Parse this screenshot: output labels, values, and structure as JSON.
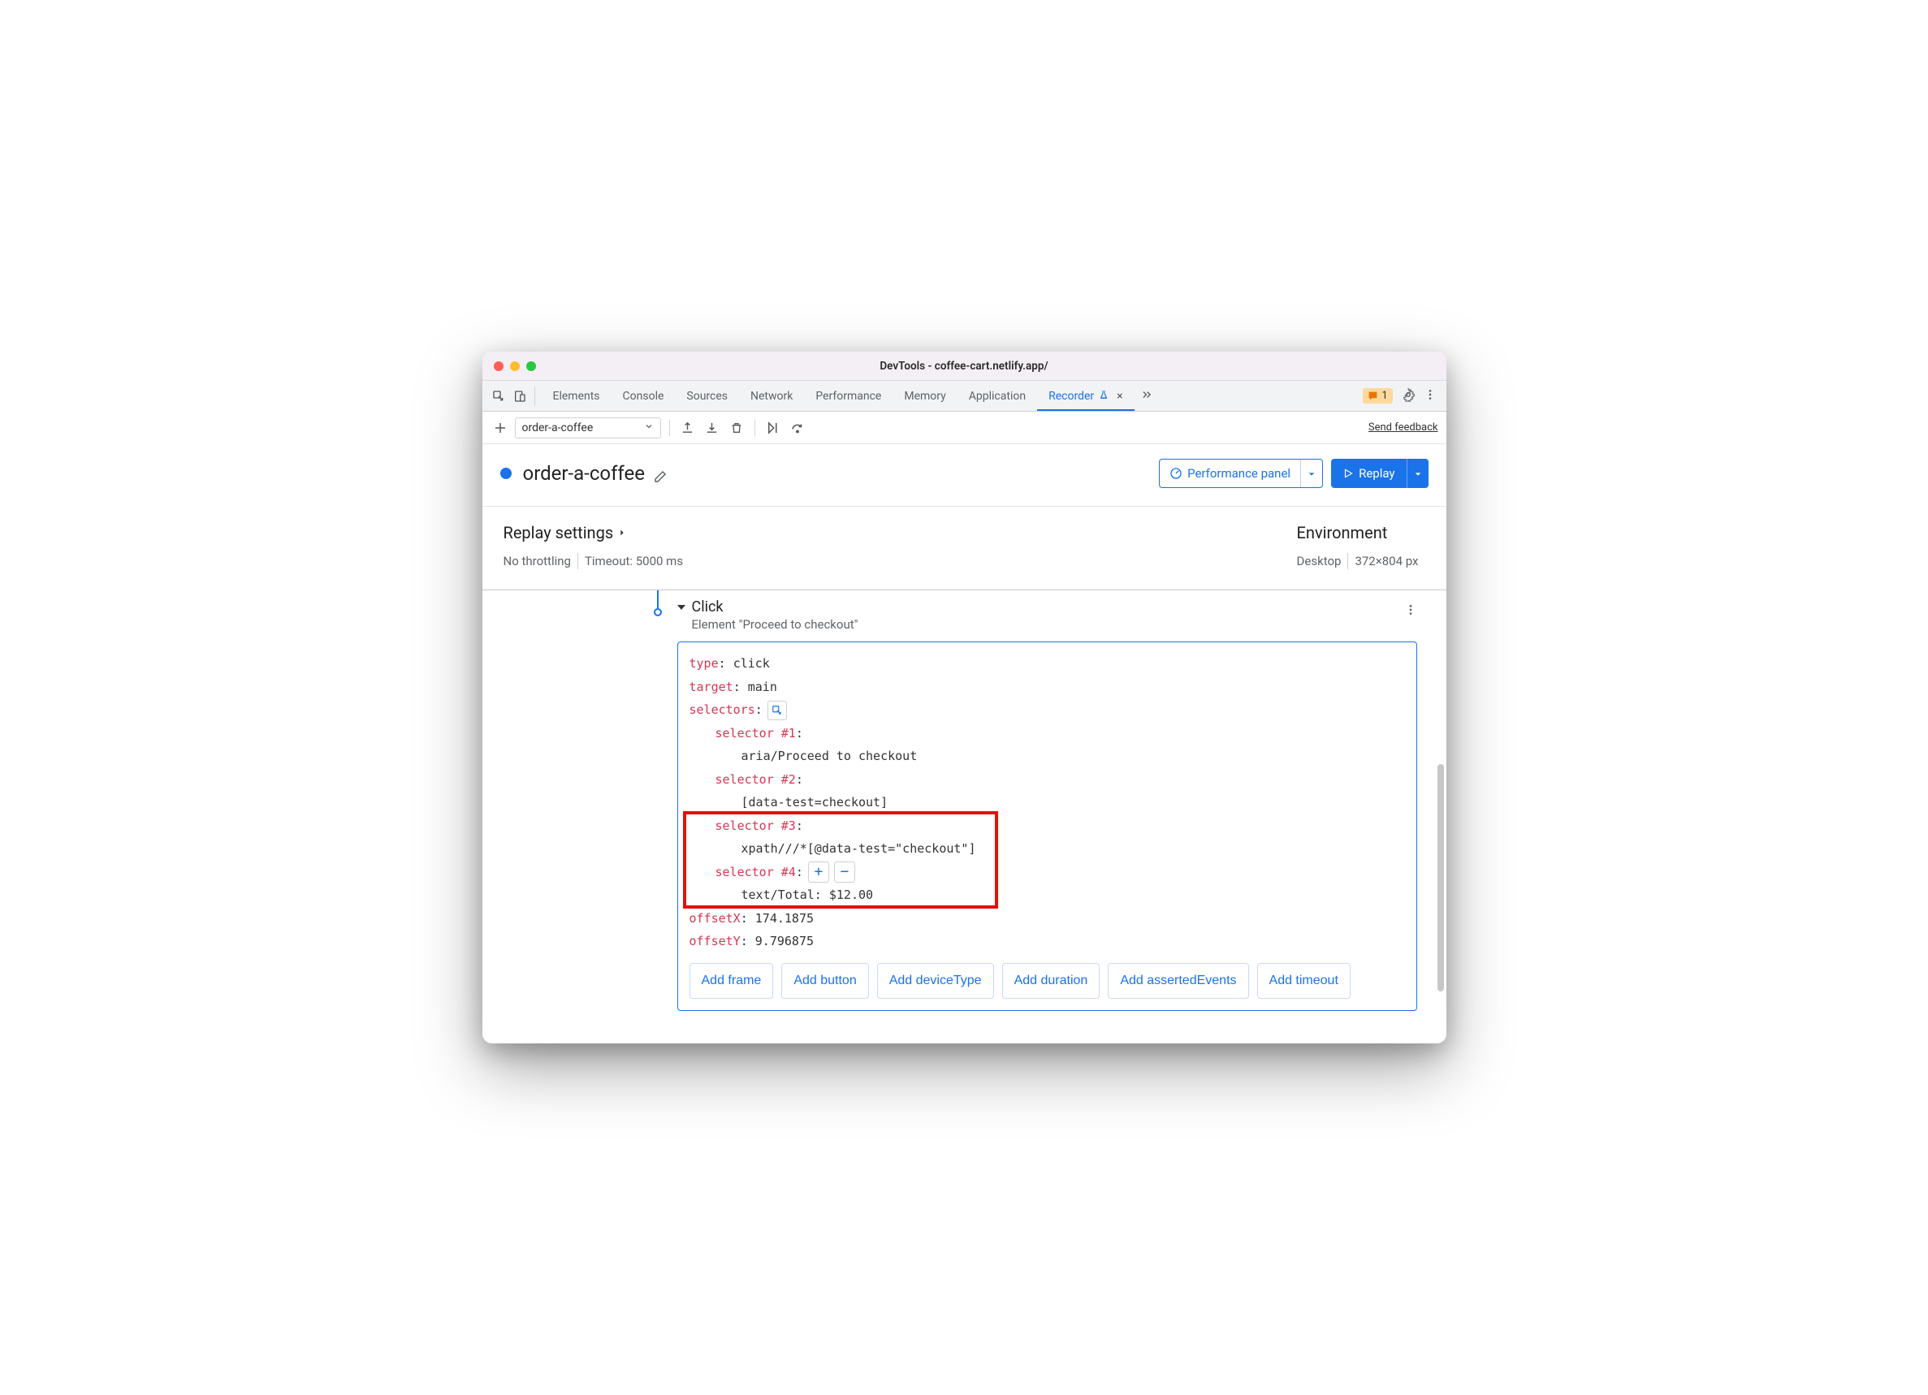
{
  "window": {
    "title": "DevTools - coffee-cart.netlify.app/"
  },
  "tabs": {
    "items": [
      "Elements",
      "Console",
      "Sources",
      "Network",
      "Performance",
      "Memory",
      "Application",
      "Recorder"
    ],
    "active_index": 7
  },
  "topbar_right": {
    "warn_count": "1"
  },
  "toolbar": {
    "recording_name": "order-a-coffee",
    "feedback": "Send feedback"
  },
  "header": {
    "name": "order-a-coffee",
    "perf_button": "Performance panel",
    "replay_button": "Replay"
  },
  "settings": {
    "replay_title": "Replay settings",
    "throttle": "No throttling",
    "timeout": "Timeout: 5000 ms",
    "env_title": "Environment",
    "device": "Desktop",
    "viewport": "372×804 px"
  },
  "step": {
    "title": "Click",
    "subtitle": "Element \"Proceed to checkout\"",
    "code": {
      "type_key": "type",
      "type_val": "click",
      "target_key": "target",
      "target_val": "main",
      "selectors_key": "selectors",
      "s1_key": "selector #1",
      "s1_val": "aria/Proceed to checkout",
      "s2_key": "selector #2",
      "s2_val": "[data-test=checkout]",
      "s3_key": "selector #3",
      "s3_val": "xpath///*[@data-test=\"checkout\"]",
      "s4_key": "selector #4",
      "s4_val": "text/Total: $12.00",
      "offsetX_key": "offsetX",
      "offsetX_val": "174.1875",
      "offsetY_key": "offsetY",
      "offsetY_val": "9.796875"
    },
    "chips": [
      "Add frame",
      "Add button",
      "Add deviceType",
      "Add duration",
      "Add assertedEvents",
      "Add timeout"
    ]
  }
}
